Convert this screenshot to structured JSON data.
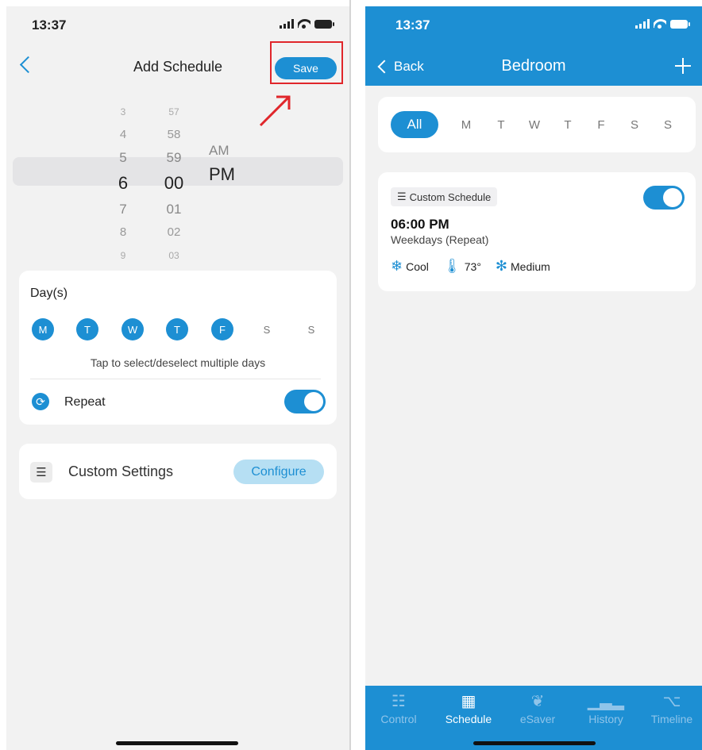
{
  "left": {
    "status_time": "13:37",
    "nav": {
      "title": "Add Schedule",
      "save_label": "Save"
    },
    "picker": {
      "hours": [
        "3",
        "4",
        "5",
        "6",
        "7",
        "8",
        "9"
      ],
      "minutes": [
        "57",
        "58",
        "59",
        "00",
        "01",
        "02",
        "03"
      ],
      "am": "AM",
      "pm": "PM"
    },
    "days_card": {
      "label": "Day(s)",
      "days": [
        {
          "letter": "M",
          "selected": true
        },
        {
          "letter": "T",
          "selected": true
        },
        {
          "letter": "W",
          "selected": true
        },
        {
          "letter": "T",
          "selected": true
        },
        {
          "letter": "F",
          "selected": true
        },
        {
          "letter": "S",
          "selected": false
        },
        {
          "letter": "S",
          "selected": false
        }
      ],
      "hint": "Tap to select/deselect multiple days",
      "repeat_label": "Repeat",
      "repeat_on": true
    },
    "custom_settings": {
      "label": "Custom Settings",
      "configure_label": "Configure"
    }
  },
  "right": {
    "status_time": "13:37",
    "nav": {
      "back_label": "Back",
      "title": "Bedroom"
    },
    "filter": {
      "all_label": "All",
      "days": [
        "M",
        "T",
        "W",
        "T",
        "F",
        "S",
        "S"
      ]
    },
    "schedule": {
      "tag": "Custom Schedule",
      "time": "06:00 PM",
      "repeat": "Weekdays (Repeat)",
      "mode": "Cool",
      "temp": "73°",
      "fan": "Medium",
      "enabled": true
    },
    "tabs": [
      {
        "label": "Control",
        "icon": "sliders-icon",
        "active": false
      },
      {
        "label": "Schedule",
        "icon": "calendar-icon",
        "active": true
      },
      {
        "label": "eSaver",
        "icon": "leaf-icon",
        "active": false
      },
      {
        "label": "History",
        "icon": "bar-chart-icon",
        "active": false
      },
      {
        "label": "Timeline",
        "icon": "timeline-icon",
        "active": false
      }
    ]
  },
  "colors": {
    "accent": "#1d8fd3",
    "highlight": "#e0262b"
  }
}
